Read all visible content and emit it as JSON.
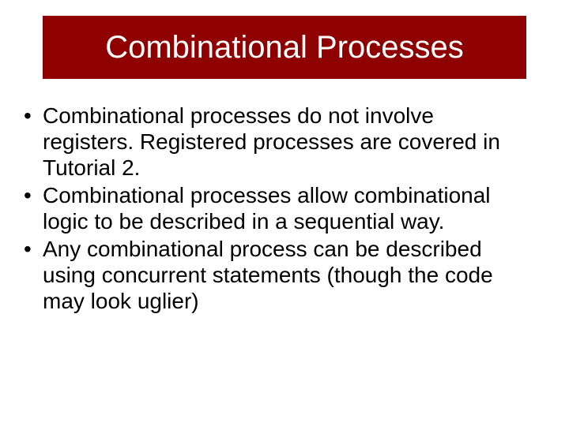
{
  "slide": {
    "title": "Combinational Processes",
    "bullets": [
      "Combinational processes do not involve registers. Registered processes are covered in Tutorial 2.",
      "Combinational processes allow combinational logic to be described in a sequential way.",
      "Any combinational process can be described using concurrent statements (though the code may look uglier)"
    ]
  }
}
